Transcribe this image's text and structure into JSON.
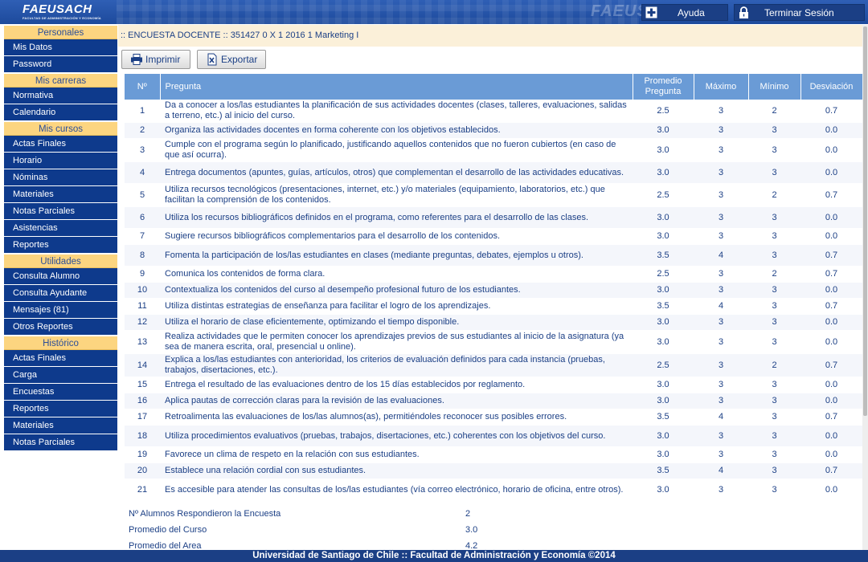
{
  "header": {
    "logo_text": "FAEUSACH",
    "logo_sub": "FACULTAD DE ADMINISTRACIÓN Y ECONOMÍA",
    "watermark": "FAEUSACH",
    "help_label": "Ayuda",
    "logout_label": "Terminar Sesión",
    "help_icon": "plus-box-icon",
    "logout_icon": "padlock-icon"
  },
  "sidebar": {
    "sections": [
      {
        "title": "Personales",
        "items": [
          "Mis Datos",
          "Password"
        ]
      },
      {
        "title": "Mis carreras",
        "items": [
          "Normativa",
          "Calendario"
        ]
      },
      {
        "title": "Mis cursos",
        "items": [
          "Actas Finales",
          "Horario",
          "Nóminas",
          "Materiales",
          "Notas Parciales",
          "Asistencias",
          "Reportes"
        ]
      },
      {
        "title": "Utilidades",
        "items": [
          "Consulta Alumno",
          "Consulta Ayudante",
          "Mensajes (81)",
          "Otros Reportes"
        ]
      },
      {
        "title": "Histórico",
        "items": [
          "Actas Finales",
          "Carga",
          "Encuestas",
          "Reportes",
          "Materiales",
          "Notas Parciales"
        ]
      }
    ]
  },
  "main": {
    "breadcrumb": ":: ENCUESTA DOCENTE :: 351427 0 X 1 2016 1 Marketing I",
    "print_label": "Imprimir",
    "export_label": "Exportar",
    "table": {
      "headers": [
        "Nº",
        "Pregunta",
        "Promedio Pregunta",
        "Máximo",
        "Mínimo",
        "Desviación"
      ],
      "rows": [
        [
          "1",
          "Da a conocer a los/las estudiantes la planificación de sus actividades docentes (clases, talleres, evaluaciones, salidas a terreno, etc.) al inicio del curso.",
          "2.5",
          "3",
          "2",
          "0.7"
        ],
        [
          "2",
          "Organiza las actividades docentes en forma coherente con los objetivos establecidos.",
          "3.0",
          "3",
          "3",
          "0.0"
        ],
        [
          "3",
          "Cumple con el programa según lo planificado, justificando aquellos contenidos que no fueron cubiertos (en caso de que así ocurra).",
          "3.0",
          "3",
          "3",
          "0.0"
        ],
        [
          "4",
          "Entrega documentos (apuntes, guías, artículos, otros) que complementan el desarrollo de las actividades educativas.",
          "3.0",
          "3",
          "3",
          "0.0"
        ],
        [
          "5",
          "Utiliza recursos tecnológicos (presentaciones, internet, etc.) y/o materiales (equipamiento, laboratorios, etc.) que facilitan la comprensión de los contenidos.",
          "2.5",
          "3",
          "2",
          "0.7"
        ],
        [
          "6",
          "Utiliza los recursos bibliográficos definidos en el programa, como referentes para el desarrollo de las clases.",
          "3.0",
          "3",
          "3",
          "0.0"
        ],
        [
          "7",
          "Sugiere recursos bibliográficos complementarios para el desarrollo de los contenidos.",
          "3.0",
          "3",
          "3",
          "0.0"
        ],
        [
          "8",
          "Fomenta la participación de los/las estudiantes en clases (mediante preguntas, debates, ejemplos u otros).",
          "3.5",
          "4",
          "3",
          "0.7"
        ],
        [
          "9",
          "Comunica los contenidos de forma clara.",
          "2.5",
          "3",
          "2",
          "0.7"
        ],
        [
          "10",
          "Contextualiza los contenidos del curso al desempeño profesional futuro de los estudiantes.",
          "3.0",
          "3",
          "3",
          "0.0"
        ],
        [
          "11",
          "Utiliza distintas estrategias de enseñanza para facilitar el logro de los aprendizajes.",
          "3.5",
          "4",
          "3",
          "0.7"
        ],
        [
          "12",
          "Utiliza el horario de clase eficientemente, optimizando el tiempo disponible.",
          "3.0",
          "3",
          "3",
          "0.0"
        ],
        [
          "13",
          "Realiza actividades que le permiten conocer los aprendizajes previos de sus estudiantes al inicio de la asignatura (ya sea de manera escrita, oral, presencial u online).",
          "3.0",
          "3",
          "3",
          "0.0"
        ],
        [
          "14",
          "Explica a los/las estudiantes con anterioridad, los criterios de evaluación definidos para cada instancia (pruebas, trabajos, disertaciones, etc.).",
          "2.5",
          "3",
          "2",
          "0.7"
        ],
        [
          "15",
          "Entrega el resultado de las evaluaciones dentro de los 15 días establecidos por reglamento.",
          "3.0",
          "3",
          "3",
          "0.0"
        ],
        [
          "16",
          "Aplica pautas de corrección claras para la revisión de las evaluaciones.",
          "3.0",
          "3",
          "3",
          "0.0"
        ],
        [
          "17",
          "Retroalimenta las evaluaciones de los/las alumnos(as), permitiéndoles reconocer sus posibles errores.",
          "3.5",
          "4",
          "3",
          "0.7"
        ],
        [
          "18",
          "Utiliza procedimientos evaluativos (pruebas, trabajos, disertaciones, etc.) coherentes con los objetivos del curso.",
          "3.0",
          "3",
          "3",
          "0.0"
        ],
        [
          "19",
          "Favorece un clima de respeto en la relación con sus estudiantes.",
          "3.0",
          "3",
          "3",
          "0.0"
        ],
        [
          "20",
          "Establece una relación cordial con sus estudiantes.",
          "3.5",
          "4",
          "3",
          "0.7"
        ],
        [
          "21",
          "Es accesible para atender las consultas de los/las estudiantes (vía correo electrónico, horario de oficina, entre otros).",
          "3.0",
          "3",
          "3",
          "0.0"
        ]
      ]
    },
    "summary": [
      {
        "label": "Nº Alumnos Respondieron la Encuesta",
        "value": "2"
      },
      {
        "label": "Promedio del Curso",
        "value": "3.0"
      },
      {
        "label": "Promedio del Area",
        "value": "4.2"
      }
    ]
  },
  "footer": {
    "text": "Universidad de Santiago de Chile :: Facultad de Administración y Economía ©2014"
  },
  "colors": {
    "header_blue": "#1d4a9c",
    "menu_blue": "#0e3a8c",
    "section_gold": "#fcd580",
    "table_header": "#6a9bd6",
    "breadcrumb_bg": "#fbf0d9"
  }
}
